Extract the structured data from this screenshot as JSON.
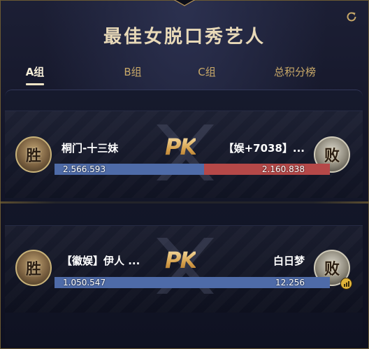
{
  "header": {
    "title": "最佳女脱口秀艺人"
  },
  "tabs": [
    {
      "label": "A组",
      "active": true
    },
    {
      "label": "B组",
      "active": false
    },
    {
      "label": "C组",
      "active": false
    },
    {
      "label": "总积分榜",
      "active": false
    }
  ],
  "matches": [
    {
      "pk_label": "PK",
      "left": {
        "result": "胜",
        "name": "桐门-十三妹",
        "score": "2.566.593"
      },
      "right": {
        "result": "败",
        "name": "【娱+7038】...",
        "score": "2.160.838"
      },
      "left_share": 0.543
    },
    {
      "pk_label": "PK",
      "left": {
        "result": "胜",
        "name": "【徽娱】伊人 ...",
        "score": "1.050.547"
      },
      "right": {
        "result": "败",
        "name": "白日梦",
        "score": "12.256"
      },
      "left_share": 1.0
    }
  ],
  "colors": {
    "accent_gold": "#c9a969",
    "bar_blue": "#4e6ba8",
    "bar_red": "#b54848"
  }
}
